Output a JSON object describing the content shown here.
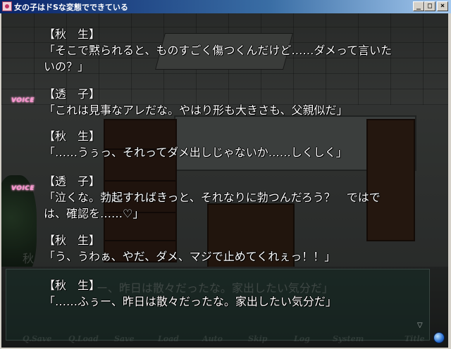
{
  "window": {
    "title": "女の子はドSな変態でできている",
    "minimize_glyph": "_",
    "maximize_glyph": "□",
    "close_glyph": "×"
  },
  "dialog": [
    {
      "name": "【秋　生】",
      "lines": [
        "「そこで黙られると、ものすごく傷つくんだけど……ダメって言いた",
        "いの？」"
      ],
      "voice": false
    },
    {
      "name": "【透　子】",
      "lines": [
        "「これは見事なアレだな。やはり形も大きさも、父親似だ」"
      ],
      "voice": true
    },
    {
      "name": "【秋　生】",
      "lines": [
        "「……うぅっ、それってダメ出しじゃないか……しくしく」"
      ],
      "voice": false
    },
    {
      "name": "【透　子】",
      "lines": [
        "「泣くな。勃起すればきっと、それなりに勃つんだろう？　ではで",
        "は、確認を……♡」"
      ],
      "voice": true
    },
    {
      "name": "【秋　生】",
      "lines": [
        "「う、うわぁ、やだ、ダメ、マジで止めてくれぇっ！！」"
      ],
      "voice": false
    },
    {
      "name": "【秋　生】",
      "lines": [
        "「……ふぅー、昨日は散々だったな。家出したい気分だ」"
      ],
      "voice": false
    }
  ],
  "voice_label": "VOICE",
  "background_name": "秋",
  "background_ghost_text": "ー、昨日は散々だったな。家出したい気分だ」",
  "menu": {
    "items": [
      "Q.Save",
      "Q.Load",
      "Save",
      "Load",
      "Auto",
      "Skip",
      "Log",
      "System",
      "Title"
    ],
    "next_arrow": "▽"
  }
}
